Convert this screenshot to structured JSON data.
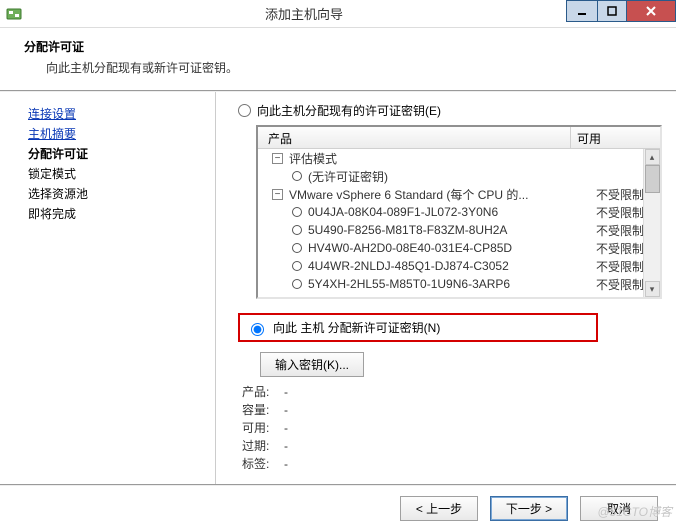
{
  "window": {
    "title": "添加主机向导"
  },
  "header": {
    "title": "分配许可证",
    "subtitle": "向此主机分配现有或新许可证密钥。"
  },
  "sidebar": {
    "items": [
      {
        "label": "连接设置",
        "type": "link"
      },
      {
        "label": "主机摘要",
        "type": "link"
      },
      {
        "label": "分配许可证",
        "type": "current"
      },
      {
        "label": "锁定模式",
        "type": "plain"
      },
      {
        "label": "选择资源池",
        "type": "plain"
      },
      {
        "label": "即将完成",
        "type": "plain"
      }
    ]
  },
  "main": {
    "radio_existing": "向此主机分配现有的许可证密钥(E)",
    "radio_new": "向此 主机 分配新许可证密钥(N)",
    "columns": {
      "product": "产品",
      "available": "可用"
    },
    "tree": {
      "group1": {
        "label": "评估模式",
        "children": [
          {
            "label": "(无许可证密钥)",
            "avail": ""
          }
        ]
      },
      "group2": {
        "label": "VMware vSphere 6 Standard (每个 CPU 的...",
        "avail": "不受限制",
        "children": [
          {
            "label": "0U4JA-08K04-089F1-JL072-3Y0N6",
            "avail": "不受限制"
          },
          {
            "label": "5U490-F8256-M81T8-F83ZM-8UH2A",
            "avail": "不受限制"
          },
          {
            "label": "HV4W0-AH2D0-08E40-031E4-CP85D",
            "avail": "不受限制"
          },
          {
            "label": "4U4WR-2NLDJ-485Q1-DJ874-C3052",
            "avail": "不受限制"
          },
          {
            "label": "5Y4XH-2HL55-M85T0-1U9N6-3ARP6",
            "avail": "不受限制"
          }
        ]
      }
    },
    "enter_key_button": "输入密钥(K)...",
    "details": {
      "product_k": "产品:",
      "product_v": "-",
      "capacity_k": "容量:",
      "capacity_v": "-",
      "available_k": "可用:",
      "available_v": "-",
      "expire_k": "过期:",
      "expire_v": "-",
      "label_k": "标签:",
      "label_v": "-"
    }
  },
  "footer": {
    "back": "< 上一步",
    "next": "下一步 >",
    "cancel": "取消"
  },
  "watermark": "@51CTO博客"
}
